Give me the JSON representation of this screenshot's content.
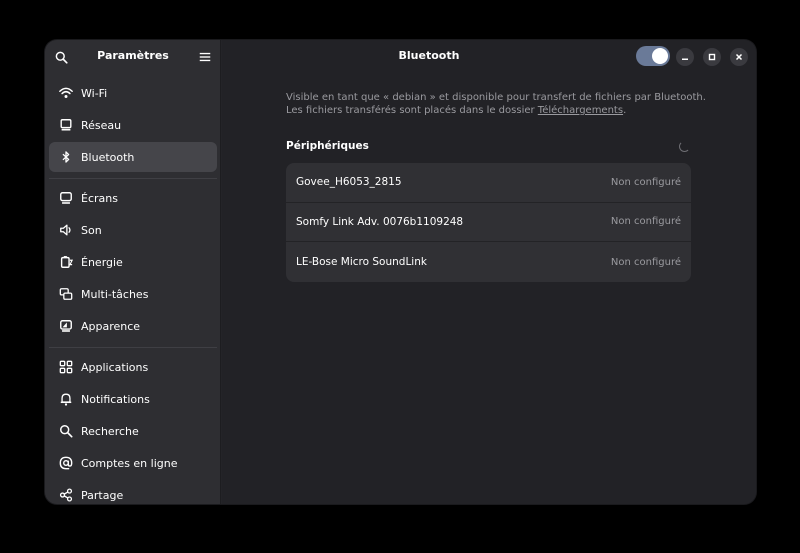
{
  "sidebar": {
    "title": "Paramètres",
    "groups": [
      [
        {
          "label": "Wi-Fi",
          "icon": "wifi-icon"
        },
        {
          "label": "Réseau",
          "icon": "network-icon"
        },
        {
          "label": "Bluetooth",
          "icon": "bluetooth-icon",
          "active": true
        }
      ],
      [
        {
          "label": "Écrans",
          "icon": "display-icon"
        },
        {
          "label": "Son",
          "icon": "speaker-icon"
        },
        {
          "label": "Énergie",
          "icon": "battery-icon"
        },
        {
          "label": "Multi-tâches",
          "icon": "multitasking-icon"
        },
        {
          "label": "Apparence",
          "icon": "appearance-icon"
        }
      ],
      [
        {
          "label": "Applications",
          "icon": "apps-grid-icon"
        },
        {
          "label": "Notifications",
          "icon": "bell-icon"
        },
        {
          "label": "Recherche",
          "icon": "search-icon"
        },
        {
          "label": "Comptes en ligne",
          "icon": "at-sign-icon"
        },
        {
          "label": "Partage",
          "icon": "share-icon"
        }
      ]
    ]
  },
  "main": {
    "title": "Bluetooth",
    "bluetooth_enabled": true,
    "description_line1": "Visible en tant que « debian » et disponible pour transfert de fichiers par Bluetooth.",
    "description_line2_prefix": "Les fichiers transférés sont placés dans le dossier ",
    "description_link": "Téléchargements",
    "description_line2_suffix": ".",
    "devices_title": "Périphériques",
    "devices": [
      {
        "name": "Govee_H6053_2815",
        "status": "Non configuré"
      },
      {
        "name": "Somfy Link Adv. 0076b1109248",
        "status": "Non configuré"
      },
      {
        "name": "LE-Bose Micro SoundLink",
        "status": "Non configuré"
      }
    ]
  },
  "colors": {
    "accent": "#6a7a98",
    "window_bg": "#222226",
    "sidebar_bg": "#2e2e32",
    "row_bg": "#303034"
  }
}
